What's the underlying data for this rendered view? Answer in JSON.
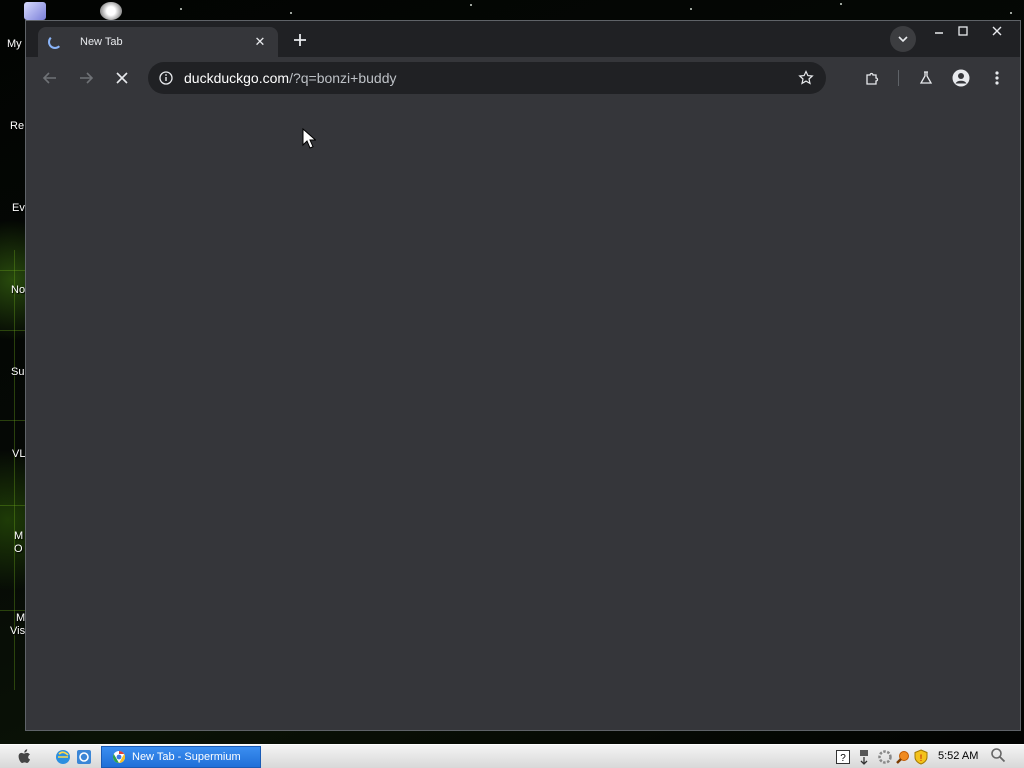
{
  "desktop": {
    "icon_labels": [
      "My",
      "Re",
      "Ev",
      "No",
      "Su",
      "VL",
      "M",
      "O",
      "M",
      "Vis"
    ]
  },
  "browser": {
    "tab": {
      "title": "New Tab",
      "state": "loading"
    },
    "omnibox": {
      "url_host": "duckduckgo.com",
      "url_rest": "/?q=bonzi+buddy"
    },
    "colors": {
      "frame": "#202124",
      "toolbar": "#35363a",
      "content": "#35363a",
      "spinner": "#8ab4f8"
    }
  },
  "taskbar": {
    "task_label": "New Tab - Supermium",
    "clock": "5:52 AM",
    "colors": {
      "task_button": "#2a7fe6"
    }
  }
}
